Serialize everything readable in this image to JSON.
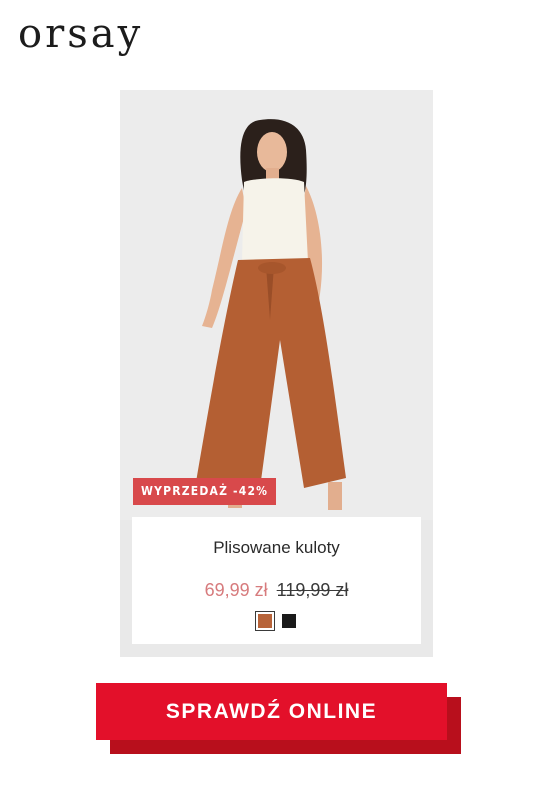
{
  "brand": {
    "logo_text": "orsay"
  },
  "product": {
    "sale_badge": "WYPRZEDAŻ -42%",
    "name": "Plisowane kuloty",
    "price_current": "69,99 zł",
    "price_original": "119,99 zł",
    "swatches": [
      {
        "color": "#b8643a",
        "selected": true
      },
      {
        "color": "#1a1a1a",
        "selected": false
      }
    ],
    "photo_icon": "model-photo"
  },
  "cta": {
    "label": "SPRAWDŹ ONLINE"
  },
  "colors": {
    "accent": "#e3102a",
    "accent_shadow": "#b80f1c",
    "badge": "#d8494b",
    "sale_price": "#d77b7d"
  }
}
